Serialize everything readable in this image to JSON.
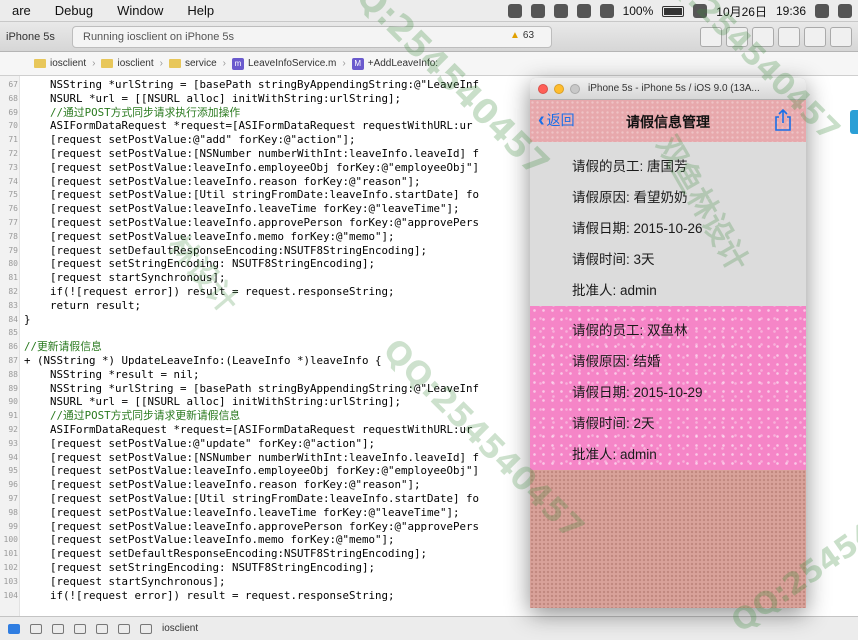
{
  "menubar": {
    "items": [
      "are",
      "Debug",
      "Window",
      "Help"
    ],
    "battery_percent": "100%",
    "date": "10月26日",
    "time": "19:36"
  },
  "toolbar": {
    "scheme": "iPhone 5s",
    "activity": "Running iosclient on iPhone 5s",
    "warning_count": "63"
  },
  "jumpbar": {
    "crumbs": [
      "iosclient",
      "iosclient",
      "service",
      "LeaveInfoService.m",
      "+AddLeaveInfo:"
    ]
  },
  "code": {
    "lines": [
      {
        "n": "67",
        "t": "    NSString *urlString = [basePath stringByAppendingString:@\"LeaveInf"
      },
      {
        "n": "68",
        "t": "    NSURL *url = [[NSURL alloc] initWithString:urlString];"
      },
      {
        "n": "69",
        "t": "    //通过POST方式同步请求执行添加操作"
      },
      {
        "n": "70",
        "t": "    ASIFormDataRequest *request=[ASIFormDataRequest requestWithURL:ur"
      },
      {
        "n": "71",
        "t": "    [request setPostValue:@\"add\" forKey:@\"action\"];"
      },
      {
        "n": "72",
        "t": "    [request setPostValue:[NSNumber numberWithInt:leaveInfo.leaveId] f"
      },
      {
        "n": "73",
        "t": "    [request setPostValue:leaveInfo.employeeObj forKey:@\"employeeObj\"]"
      },
      {
        "n": "74",
        "t": "    [request setPostValue:leaveInfo.reason forKey:@\"reason\"];"
      },
      {
        "n": "75",
        "t": "    [request setPostValue:[Util stringFromDate:leaveInfo.startDate] fo"
      },
      {
        "n": "76",
        "t": "    [request setPostValue:leaveInfo.leaveTime forKey:@\"leaveTime\"];"
      },
      {
        "n": "77",
        "t": "    [request setPostValue:leaveInfo.approvePerson forKey:@\"approvePers"
      },
      {
        "n": "78",
        "t": "    [request setPostValue:leaveInfo.memo forKey:@\"memo\"];"
      },
      {
        "n": "79",
        "t": "    [request setDefaultResponseEncoding:NSUTF8StringEncoding];"
      },
      {
        "n": "80",
        "t": "    [request setStringEncoding: NSUTF8StringEncoding];"
      },
      {
        "n": "81",
        "t": "    [request startSynchronous];"
      },
      {
        "n": "82",
        "t": "    if(![request error]) result = request.responseString;"
      },
      {
        "n": "83",
        "t": "    return result;"
      },
      {
        "n": "84",
        "t": "}"
      },
      {
        "n": "85",
        "t": ""
      },
      {
        "n": "86",
        "t": "//更新请假信息"
      },
      {
        "n": "87",
        "t": "+ (NSString *) UpdateLeaveInfo:(LeaveInfo *)leaveInfo {"
      },
      {
        "n": "88",
        "t": "    NSString *result = nil;"
      },
      {
        "n": "89",
        "t": "    NSString *urlString = [basePath stringByAppendingString:@\"LeaveInf"
      },
      {
        "n": "90",
        "t": "    NSURL *url = [[NSURL alloc] initWithString:urlString];"
      },
      {
        "n": "91",
        "t": "    //通过POST方式同步请求更新请假信息"
      },
      {
        "n": "92",
        "t": "    ASIFormDataRequest *request=[ASIFormDataRequest requestWithURL:ur"
      },
      {
        "n": "93",
        "t": "    [request setPostValue:@\"update\" forKey:@\"action\"];"
      },
      {
        "n": "94",
        "t": "    [request setPostValue:[NSNumber numberWithInt:leaveInfo.leaveId] f"
      },
      {
        "n": "95",
        "t": "    [request setPostValue:leaveInfo.employeeObj forKey:@\"employeeObj\"]"
      },
      {
        "n": "96",
        "t": "    [request setPostValue:leaveInfo.reason forKey:@\"reason\"];"
      },
      {
        "n": "97",
        "t": "    [request setPostValue:[Util stringFromDate:leaveInfo.startDate] fo"
      },
      {
        "n": "98",
        "t": "    [request setPostValue:leaveInfo.leaveTime forKey:@\"leaveTime\"];"
      },
      {
        "n": "99",
        "t": "    [request setPostValue:leaveInfo.approvePerson forKey:@\"approvePers"
      },
      {
        "n": "100",
        "t": "    [request setPostValue:leaveInfo.memo forKey:@\"memo\"];"
      },
      {
        "n": "101",
        "t": "    [request setDefaultResponseEncoding:NSUTF8StringEncoding];"
      },
      {
        "n": "102",
        "t": "    [request setStringEncoding: NSUTF8StringEncoding];"
      },
      {
        "n": "103",
        "t": "    [request startSynchronous];"
      },
      {
        "n": "104",
        "t": "    if(![request error]) result = request.responseString;"
      }
    ]
  },
  "debugbar": {
    "target": "iosclient"
  },
  "simulator": {
    "window_title": "iPhone 5s - iPhone 5s / iOS 9.0 (13A...",
    "nav": {
      "back_label": "返回",
      "title": "请假信息管理"
    },
    "records": [
      {
        "employee": "请假的员工: 唐国芳",
        "reason": "请假原因: 看望奶奶",
        "date": "请假日期: 2015-10-26",
        "duration": "请假时间: 3天",
        "approver": "批准人: admin"
      },
      {
        "employee": "请假的员工: 双鱼林",
        "reason": "请假原因: 结婚",
        "date": "请假日期: 2015-10-29",
        "duration": "请假时间: 2天",
        "approver": "批准人: admin"
      }
    ]
  },
  "watermarks": [
    "QQ:254540457",
    "双鱼林设计",
    "林设计",
    "QQ:25454"
  ],
  "colors": {
    "keyword": "#b21a8f",
    "string": "#c41a16",
    "comment": "#2a7a1f",
    "class": "#5c2699",
    "ios_link": "#1a6fe8",
    "watermark": "#3a8a3a"
  }
}
